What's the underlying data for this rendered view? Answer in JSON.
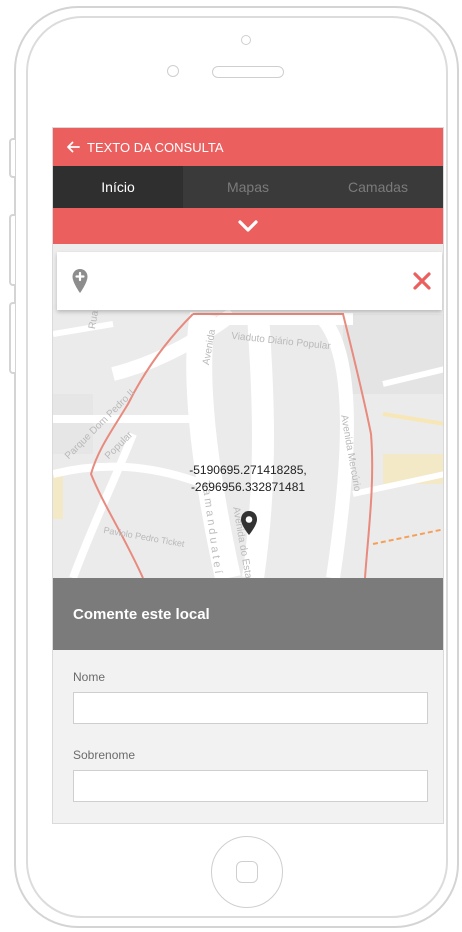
{
  "header": {
    "back_label": "TEXTO DA CONSULTA"
  },
  "tabs": [
    {
      "label": "Início",
      "active": true
    },
    {
      "label": "Mapas",
      "active": false
    },
    {
      "label": "Camadas",
      "active": false
    }
  ],
  "map": {
    "coordinates_line1": "-5190695.271418285,",
    "coordinates_line2": "-2696956.332871481",
    "street_labels": [
      "Viaduto Diário Popular",
      "Avenida",
      "Avenida Mercúrio",
      "Parque Dom Pedro II",
      "Popular",
      "Paviolo Pedro Ticket",
      "Tamanduateí",
      "Avenida do Estado",
      "Rua"
    ]
  },
  "comment": {
    "title": "Comente este local",
    "fields": [
      {
        "label": "Nome",
        "value": "",
        "placeholder": ""
      },
      {
        "label": "Sobrenome",
        "value": "",
        "placeholder": ""
      }
    ]
  },
  "colors": {
    "accent": "#ec5f5f",
    "tabs_bg": "#3a3a3a",
    "section_header": "#7b7b7b",
    "route": "#e88a7e"
  },
  "icons": [
    "arrow-left-icon",
    "chevron-down-icon",
    "add-location-icon",
    "close-icon",
    "map-pin-icon"
  ]
}
